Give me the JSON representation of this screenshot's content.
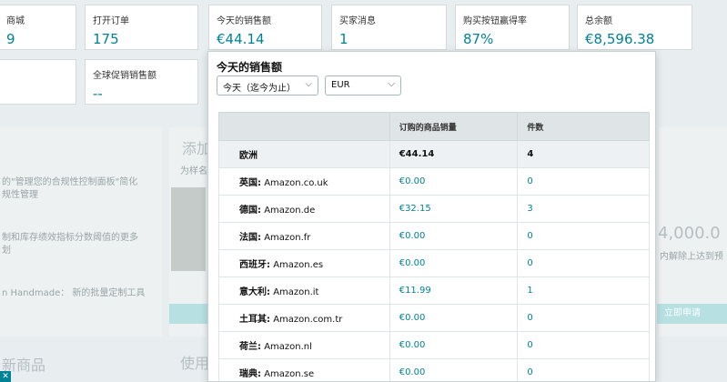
{
  "top_cards": [
    {
      "label": "商城",
      "value": "9"
    },
    {
      "label": "打开订单",
      "value": "175"
    },
    {
      "label": "今天的销售额",
      "value": "€44.14"
    },
    {
      "label": "买家消息",
      "value": "1"
    },
    {
      "label": "购买按钮赢得率",
      "value": "87%"
    },
    {
      "label": "总余额",
      "value": "€8,596.38"
    }
  ],
  "second_row": {
    "label": "全球促销销售额",
    "value": "--"
  },
  "background": {
    "left_text_1": "的\"管理您的合规性控制面板\"简化\n规性管理",
    "left_text_2": "制和库存绩效指标分数阈值的更多\n划",
    "left_text_3": "n Handmade： 新的批量定制工具",
    "add_title": "添加",
    "add_sub": "为样名",
    "right_amount": "4,000.0",
    "right_sub": "内解除上达到预",
    "right_button": "立即申请",
    "left_bottom_title": "新商品",
    "mid_bottom_title": "使用"
  },
  "popup": {
    "title": "今天的销售额",
    "period_select": "今天（迄今为止）",
    "currency_select": "EUR",
    "table": {
      "headers": [
        "",
        "订购的商品销量",
        "件数"
      ],
      "region_row": {
        "name": "欧洲",
        "sales": "€44.14",
        "units": "4"
      },
      "rows": [
        {
          "country": "英国:",
          "site": "Amazon.co.uk",
          "sales": "€0.00",
          "units": "0"
        },
        {
          "country": "德国:",
          "site": "Amazon.de",
          "sales": "€32.15",
          "units": "3"
        },
        {
          "country": "法国:",
          "site": "Amazon.fr",
          "sales": "€0.00",
          "units": "0"
        },
        {
          "country": "西班牙:",
          "site": "Amazon.es",
          "sales": "€0.00",
          "units": "0"
        },
        {
          "country": "意大利:",
          "site": "Amazon.it",
          "sales": "€11.99",
          "units": "1"
        },
        {
          "country": "土耳其:",
          "site": "Amazon.com.tr",
          "sales": "€0.00",
          "units": "0"
        },
        {
          "country": "荷兰:",
          "site": "Amazon.nl",
          "sales": "€0.00",
          "units": "0"
        },
        {
          "country": "瑞典:",
          "site": "Amazon.se",
          "sales": "€0.00",
          "units": "0"
        }
      ]
    }
  },
  "colors": {
    "teal": "#008296",
    "header_bg": "#dfe4e6"
  }
}
